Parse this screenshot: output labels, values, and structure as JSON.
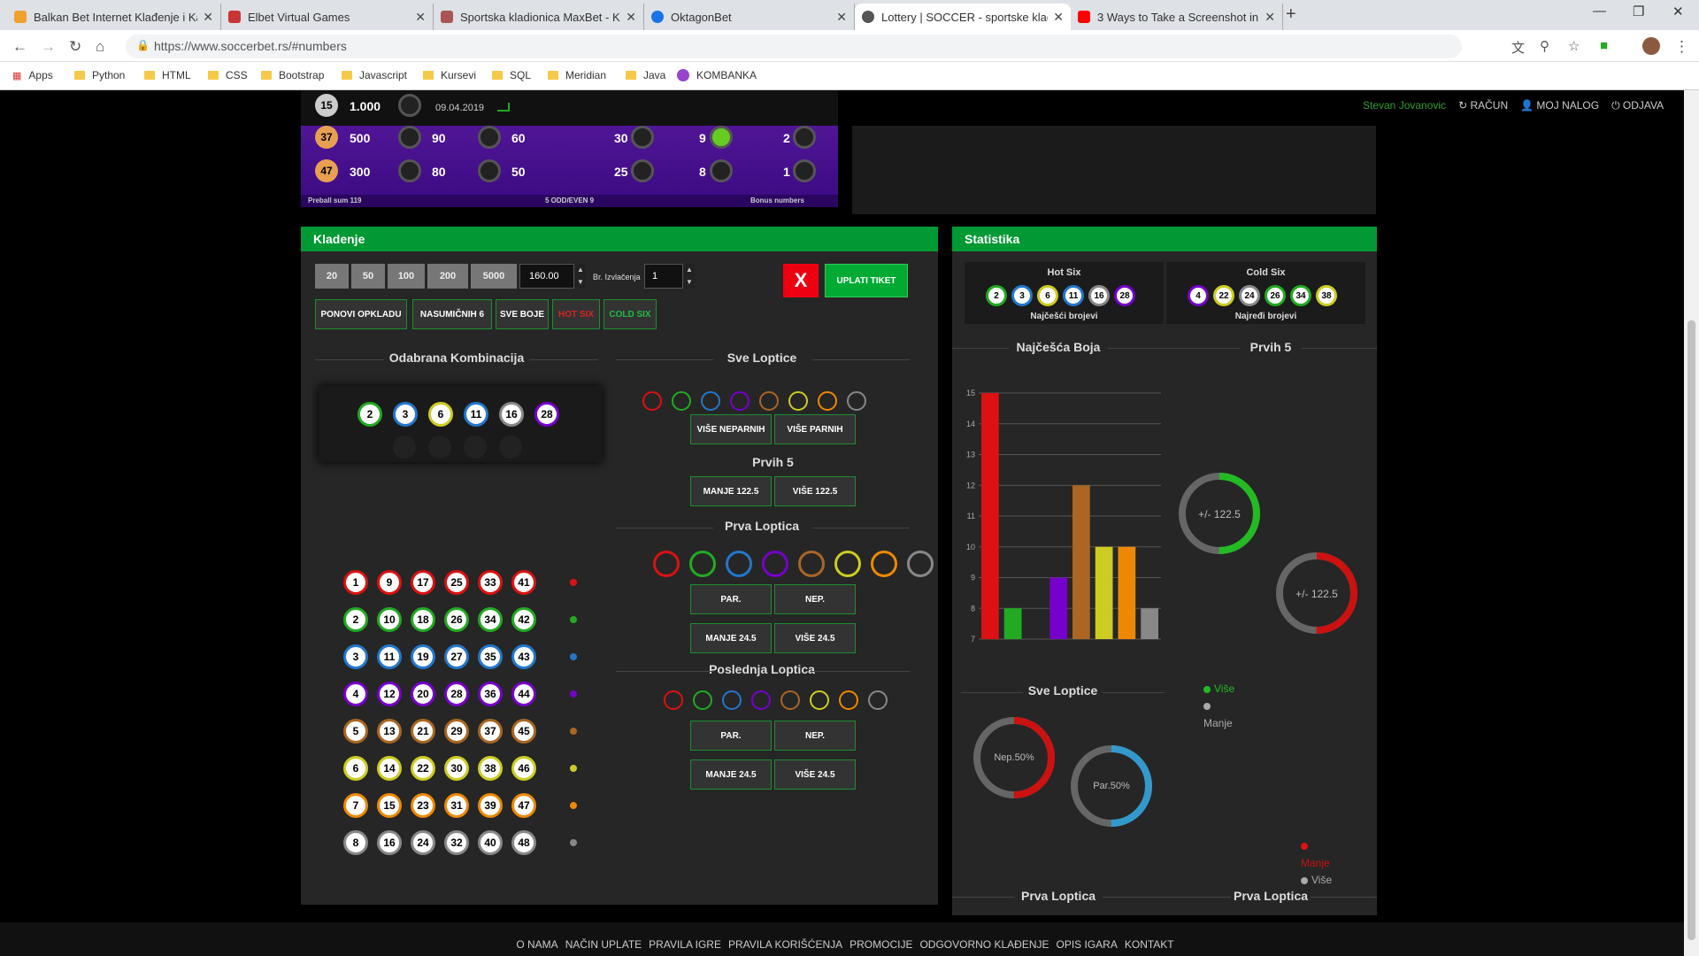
{
  "browser": {
    "tabs": [
      {
        "title": "Balkan Bet Internet Klađenje i Ka",
        "color": "#f0a030"
      },
      {
        "title": "Elbet Virtual Games",
        "color": "#c33"
      },
      {
        "title": "Sportska kladionica MaxBet - Kla",
        "color": "#a55"
      },
      {
        "title": "OktagonBet",
        "color": "#1a73e8"
      },
      {
        "title": "Lottery | SOCCER - sportske klađ",
        "color": "#555"
      },
      {
        "title": "3 Ways to Take a Screenshot in W",
        "color": "#f00"
      }
    ],
    "url": "https://www.soccerbet.rs/#numbers",
    "bookmarks": [
      "Apps",
      "Python",
      "HTML",
      "CSS",
      "Bootstrap",
      "Javascript",
      "Kursevi",
      "SQL",
      "Meridian",
      "Java",
      "KOMBANKA"
    ]
  },
  "top": {
    "user": "Stevan Jovanovic",
    "racun": "RAČUN",
    "moj": "MOJ NALOG",
    "odjava": "ODJAVA",
    "date": "09.04.2019"
  },
  "banner": {
    "rows": [
      [
        "1.000"
      ],
      [
        "500",
        "90",
        "60",
        "30",
        "9",
        "2"
      ],
      [
        "300",
        "80",
        "50",
        "25",
        "8",
        "1"
      ]
    ],
    "balls": [
      "15",
      "37",
      "47"
    ],
    "footer_left": "Preball sum 119",
    "footer_mid": "5 ODD/EVEN 9",
    "footer_right": "Bonus numbers"
  },
  "betting": {
    "title": "Kladenje",
    "stakes": [
      "20",
      "50",
      "100",
      "200",
      "5000"
    ],
    "stake_value": "160.00",
    "draws_label": "Br. Izvlačenja",
    "draws_value": "1",
    "x": "X",
    "submit": "UPLATI TIKET",
    "actions": [
      "PONOVI OPKLADU",
      "NASUMIČNIH 6",
      "SVE BOJE",
      "HOT SIX",
      "COLD SIX"
    ],
    "combo_title": "Odabrana Kombinacija",
    "combo": [
      "2",
      "3",
      "6",
      "11",
      "16",
      "28"
    ],
    "sve_title": "Sve Loptice",
    "vise_nep": "VIŠE NEPARNIH",
    "vise_par": "VIŠE PARNIH",
    "prvih_title": "Prvih 5",
    "manje1225": "MANJE 122.5",
    "vise1225": "VIŠE 122.5",
    "prva_title": "Prva Loptica",
    "posl_title": "Poslednja Loptica",
    "par": "PAR.",
    "nep": "NEP.",
    "manje245": "MANJE 24.5",
    "vise245": "VIŠE 24.5"
  },
  "grid": [
    [
      "1",
      "9",
      "17",
      "25",
      "33",
      "41"
    ],
    [
      "2",
      "10",
      "18",
      "26",
      "34",
      "42"
    ],
    [
      "3",
      "11",
      "19",
      "27",
      "35",
      "43"
    ],
    [
      "4",
      "12",
      "20",
      "28",
      "36",
      "44"
    ],
    [
      "5",
      "13",
      "21",
      "29",
      "37",
      "45"
    ],
    [
      "6",
      "14",
      "22",
      "30",
      "38",
      "46"
    ],
    [
      "7",
      "15",
      "23",
      "31",
      "39",
      "47"
    ],
    [
      "8",
      "16",
      "24",
      "32",
      "40",
      "48"
    ]
  ],
  "colors": [
    "#d11",
    "#2a2",
    "#27c",
    "#70c",
    "#a62",
    "#cc2",
    "#e80",
    "#888"
  ],
  "stats": {
    "title": "Statistika",
    "hot": "Hot Six",
    "hot_nums": [
      "2",
      "3",
      "6",
      "11",
      "16",
      "28"
    ],
    "hot_sub": "Najčešći brojevi",
    "cold": "Cold Six",
    "cold_nums": [
      "4",
      "22",
      "24",
      "26",
      "34",
      "38"
    ],
    "cold_sub": "Najređi brojevi",
    "boja": "Najčešća Boja",
    "prvih5": "Prvih 5",
    "pm1": "+/- 122.5",
    "pm2": "+/- 122.5",
    "vise": "Više",
    "manje": "Manje",
    "sve": "Sve Loptice",
    "nep": "Nep.50%",
    "par": "Par.50%",
    "prva1": "Prva Loptica",
    "prva2": "Prva Loptica",
    "manje2": "Manje",
    "vise2": "Više"
  },
  "chart_data": {
    "type": "bar",
    "categories": [
      "red",
      "green",
      "blue",
      "purple",
      "brown",
      "yellow",
      "orange",
      "gray"
    ],
    "values": [
      15,
      8,
      7,
      9,
      12,
      10,
      10,
      8
    ],
    "colors": [
      "#d11",
      "#2a2",
      "#27c",
      "#70c",
      "#a62",
      "#cc2",
      "#e80",
      "#888"
    ],
    "ylim": [
      7,
      15
    ],
    "yticks": [
      "7",
      "8",
      "9",
      "10",
      "11",
      "12",
      "13",
      "14",
      "15"
    ]
  },
  "footer": [
    "O NAMA",
    "NAČIN UPLATE",
    "PRAVILA IGRE",
    "PRAVILA KORIŠĆENJA",
    "PROMOCIJE",
    "ODGOVORNO KLAĐENJE",
    "OPIS IGARA",
    "KONTAKT"
  ]
}
